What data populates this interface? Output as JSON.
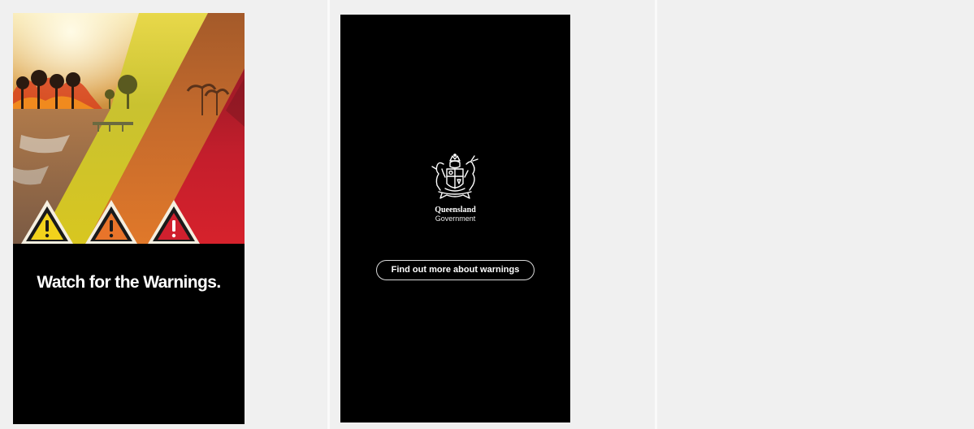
{
  "story_cards": [
    {
      "headline": "Watch for the Warnings.",
      "warning_icons": [
        "warning-yellow",
        "warning-orange",
        "warning-red"
      ],
      "colors": {
        "yellow": "#f2d21c",
        "orange": "#e8742a",
        "red": "#d0202e"
      }
    },
    {
      "logo_line1": "Queensland",
      "logo_line2": "Government",
      "cta_label": "Find out more about warnings"
    }
  ]
}
